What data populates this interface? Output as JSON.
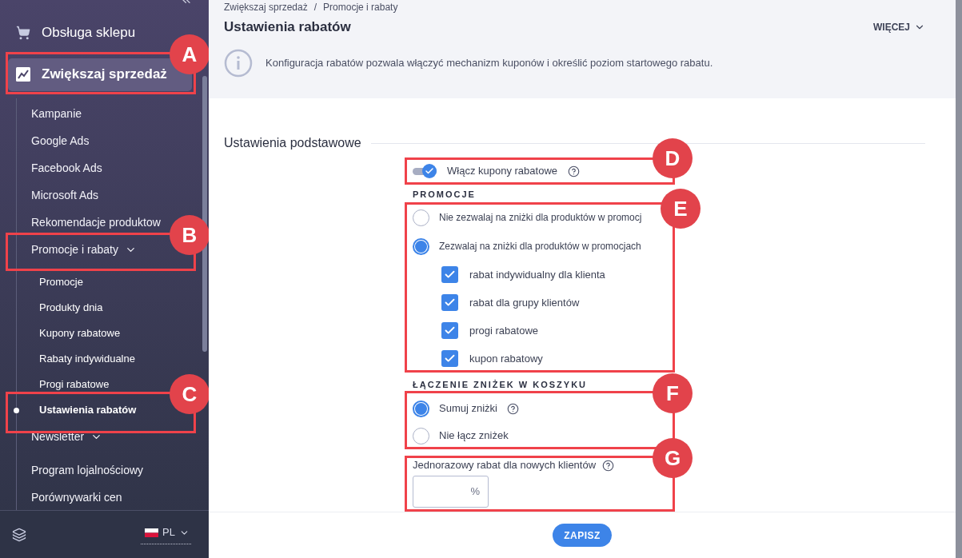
{
  "sidebar": {
    "sections": [
      {
        "label": "Obsługa sklepu",
        "selected": false
      },
      {
        "label": "Zwiększaj sprzedaż",
        "selected": true,
        "callout": "A",
        "children": [
          {
            "label": "Kampanie",
            "selected": false
          },
          {
            "label": "Google Ads",
            "selected": false
          },
          {
            "label": "Facebook Ads",
            "selected": false
          },
          {
            "label": "Microsoft Ads",
            "selected": false
          },
          {
            "label": "Rekomendacje produktow",
            "selected": false
          },
          {
            "label": "Promocje i rabaty",
            "selected": false,
            "expanded": true,
            "callout": "B",
            "children": [
              {
                "label": "Promocje",
                "selected": false
              },
              {
                "label": "Produkty dnia",
                "selected": false
              },
              {
                "label": "Kupony rabatowe",
                "selected": false
              },
              {
                "label": "Rabaty indywidualne",
                "selected": false
              },
              {
                "label": "Progi rabatowe",
                "selected": false
              },
              {
                "label": "Ustawienia rabatów",
                "selected": true,
                "callout": "C"
              }
            ]
          },
          {
            "label": "Newsletter",
            "selected": false,
            "expanded": false
          },
          {
            "label": "Program lojalnościowy",
            "selected": false
          },
          {
            "label": "Porównywarki cen",
            "selected": false
          }
        ]
      }
    ],
    "language": "PL"
  },
  "breadcrumbs": [
    "Zwiększaj sprzedaż",
    "Promocje i rabaty"
  ],
  "breadcrumb_separator": "/",
  "title": "Ustawienia rabatów",
  "more_button": "WIĘCEJ",
  "info": "Konfiguracja rabatów pozwala włączyć mechanizm kuponów i określić poziom startowego rabatu.",
  "section_title": "Ustawienia podstawowe",
  "coupons_toggle": {
    "label": "Włącz kupony rabatowe",
    "on": true,
    "help": true,
    "callout": "D"
  },
  "promotions": {
    "heading": "PROMOCJE",
    "callout": "E",
    "options": [
      {
        "label": "Nie zezwalaj na zniżki dla produktów w promocj",
        "selected": false
      },
      {
        "label": "Zezwalaj na zniżki dla produktów w promocjach",
        "selected": true,
        "checkboxes": [
          {
            "label": "rabat indywidualny dla klienta",
            "checked": true
          },
          {
            "label": "rabat dla grupy klientów",
            "checked": true
          },
          {
            "label": "progi rabatowe",
            "checked": true
          },
          {
            "label": "kupon rabatowy",
            "checked": true
          }
        ]
      }
    ]
  },
  "combining": {
    "heading": "ŁĄCZENIE ZNIŻEK W KOSZYKU",
    "callout": "F",
    "options": [
      {
        "label": "Sumuj zniżki",
        "selected": true,
        "help": true
      },
      {
        "label": "Nie łącz zniżek",
        "selected": false
      }
    ]
  },
  "new_customer_discount": {
    "label": "Jednorazowy rabat dla nowych klientów",
    "help": true,
    "unit": "%",
    "callout": "G"
  },
  "save_button": "ZAPISZ"
}
